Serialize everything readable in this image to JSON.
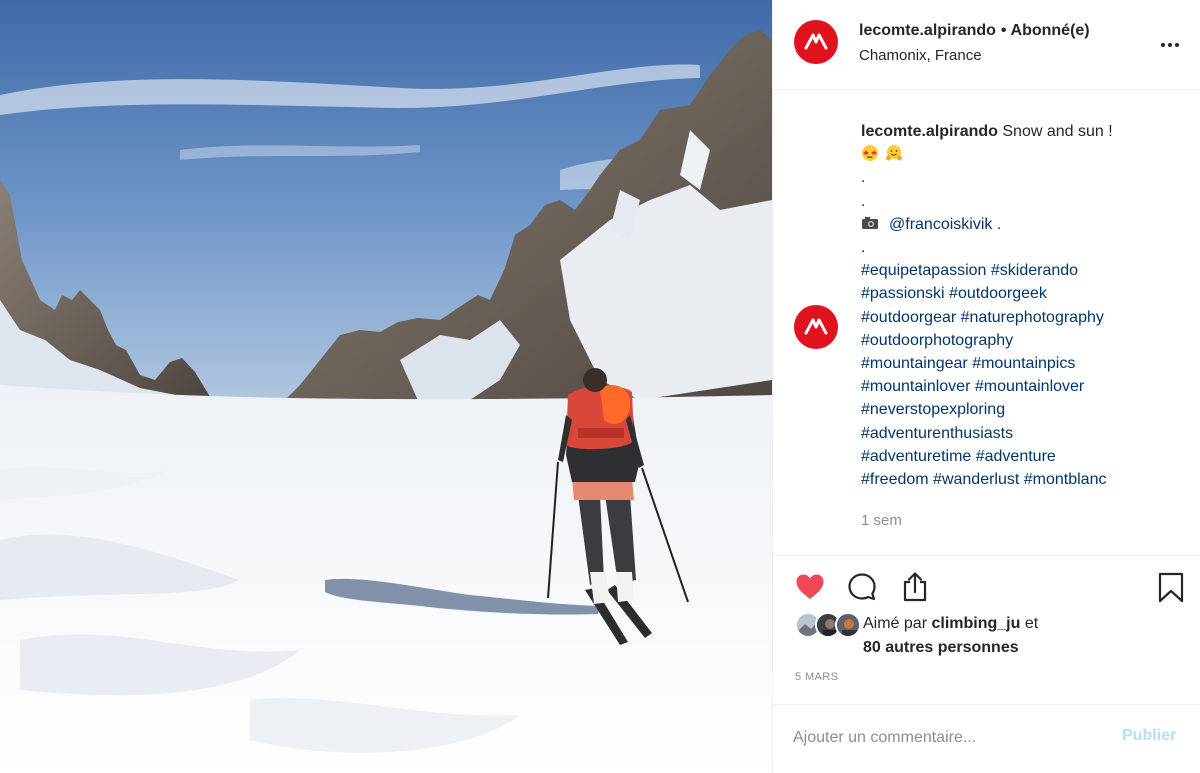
{
  "header": {
    "username": "lecomte.alpirando",
    "separator": "•",
    "follow_status": "Abonné(e)",
    "location": "Chamonix, France"
  },
  "caption": {
    "username": "lecomte.alpirando",
    "text": "Snow and sun !",
    "dots": [
      ".",
      ".",
      "."
    ],
    "mention": "@francoiskivik",
    "mention_suffix": ".",
    "hashtag_lines": [
      "#equipetapassion #skiderando",
      "#passionski #outdoorgeek",
      "#outdoorgear #naturephotography",
      "#outdoorphotography",
      "#mountaingear #mountainpics",
      "#mountainlover #mountainlover",
      "#neverstopexploring",
      "#adventurenthusiasts",
      "#adventuretime #adventure",
      "#freedom #wanderlust #montblanc"
    ],
    "time_ago": "1 sem"
  },
  "likes": {
    "prefix": "Aimé par",
    "liker": "climbing_ju",
    "conjunction": "et",
    "others": "80 autres personnes"
  },
  "date": "5 MARS",
  "comment": {
    "placeholder": "Ajouter un commentaire...",
    "publish_label": "Publier"
  },
  "icons": {
    "more": "more-options-icon",
    "like": "heart-icon",
    "comment": "comment-icon",
    "share": "share-icon",
    "save": "bookmark-icon",
    "camera": "camera-icon",
    "emoji_1": "star-struck-emoji-icon",
    "emoji_2": "hugging-emoji-icon"
  },
  "colors": {
    "brand": "#e0121e",
    "link": "#00376b",
    "liked": "#ed4956",
    "muted": "#8e8e8e",
    "publish_disabled": "#b2dffc"
  }
}
